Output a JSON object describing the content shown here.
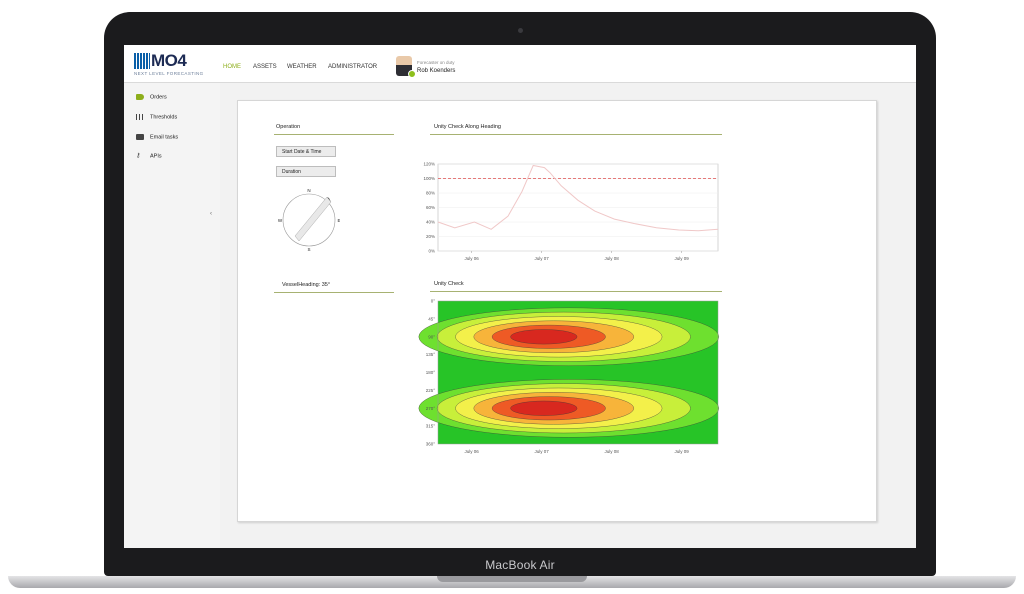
{
  "device_label": "MacBook Air",
  "app": {
    "logo_text": "MO4",
    "logo_tagline": "NEXT LEVEL FORECASTING",
    "nav": [
      {
        "label": "HOME",
        "active": true
      },
      {
        "label": "ASSETS",
        "active": false
      },
      {
        "label": "WEATHER",
        "active": false
      },
      {
        "label": "ADMINISTRATOR",
        "active": false
      }
    ],
    "user": {
      "role": "Forecaster on duty",
      "name": "Rob Koenders"
    },
    "accent_color": "#8dae1b"
  },
  "sidebar": {
    "items": [
      {
        "label": "Orders",
        "icon": "tag-icon"
      },
      {
        "label": "Thresholds",
        "icon": "bar-chart-icon"
      },
      {
        "label": "Email tasks",
        "icon": "mail-icon"
      },
      {
        "label": "APIs",
        "icon": "key-icon"
      }
    ],
    "collapse_glyph": "‹"
  },
  "operation": {
    "title": "Operation",
    "start_button": "Start Date & Time",
    "duration_button": "Duration",
    "compass": {
      "n": "N",
      "e": "E",
      "s": "S",
      "w": "W"
    },
    "vessel_heading_label": "VesselHeading: 35°"
  },
  "chart_data": [
    {
      "type": "line",
      "title": "Unity Check Along Heading",
      "x_ticks": [
        "July 06",
        "July 07",
        "July 08",
        "July 09"
      ],
      "y_ticks": [
        "0%",
        "20%",
        "40%",
        "60%",
        "80%",
        "100%",
        "120%"
      ],
      "ylim": [
        0,
        120
      ],
      "threshold": 100,
      "threshold_color": "#e05050",
      "series": [
        {
          "color": "#f0c8c8",
          "x": [
            0,
            0.06,
            0.13,
            0.19,
            0.25,
            0.3,
            0.34,
            0.38,
            0.4,
            0.44,
            0.5,
            0.56,
            0.63,
            0.7,
            0.78,
            0.86,
            0.93,
            1.0
          ],
          "y": [
            40,
            32,
            40,
            30,
            48,
            82,
            118,
            115,
            108,
            90,
            70,
            55,
            44,
            38,
            32,
            29,
            28,
            30
          ]
        }
      ]
    },
    {
      "type": "heatmap",
      "title": "Unity Check",
      "x_ticks": [
        "July 06",
        "July 07",
        "July 08",
        "July 09"
      ],
      "y_ticks": [
        "0°",
        "45°",
        "90°",
        "135°",
        "180°",
        "225°",
        "270°",
        "315°",
        "360°"
      ],
      "peaks": [
        {
          "x": 0.36,
          "y_deg": 90,
          "value": 1.0
        },
        {
          "x": 0.36,
          "y_deg": 270,
          "value": 1.0
        }
      ],
      "colors": [
        "#27c427",
        "#6ee02f",
        "#c8ef3a",
        "#f3f04a",
        "#f7b43a",
        "#ee5a25",
        "#d8281f"
      ]
    }
  ]
}
